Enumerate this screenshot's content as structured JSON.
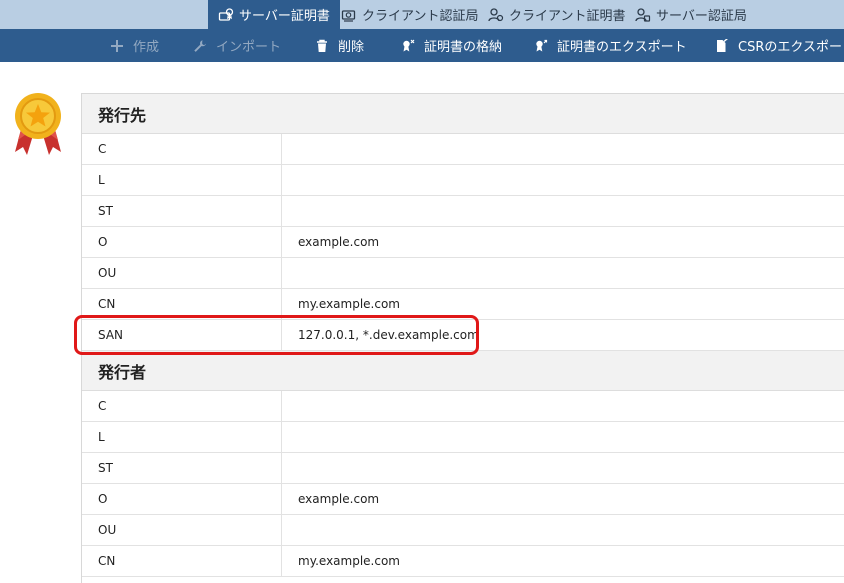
{
  "tabs": [
    {
      "label": "サーバー証明書",
      "icon": "server-cert-icon",
      "active": true
    },
    {
      "label": "クライアント認証局",
      "icon": "client-ca-icon",
      "active": false
    },
    {
      "label": "クライアント証明書",
      "icon": "client-cert-icon",
      "active": false
    },
    {
      "label": "サーバー認証局",
      "icon": "server-ca-icon",
      "active": false
    }
  ],
  "toolbar": [
    {
      "label": "作成",
      "icon": "plus-icon",
      "enabled": false
    },
    {
      "label": "インポート",
      "icon": "wrench-icon",
      "enabled": false
    },
    {
      "label": "削除",
      "icon": "trash-icon",
      "enabled": true
    },
    {
      "label": "証明書の格納",
      "icon": "cert-store-icon",
      "enabled": true
    },
    {
      "label": "証明書のエクスポート",
      "icon": "cert-export-icon",
      "enabled": true
    },
    {
      "label": "CSRのエクスポート",
      "icon": "file-export-icon",
      "enabled": true
    }
  ],
  "subject": {
    "title": "発行先",
    "rows": [
      {
        "key": "C",
        "value": ""
      },
      {
        "key": "L",
        "value": ""
      },
      {
        "key": "ST",
        "value": ""
      },
      {
        "key": "O",
        "value": "example.com"
      },
      {
        "key": "OU",
        "value": ""
      },
      {
        "key": "CN",
        "value": "my.example.com"
      },
      {
        "key": "SAN",
        "value": "127.0.0.1, *.dev.example.com"
      }
    ]
  },
  "issuer": {
    "title": "発行者",
    "rows": [
      {
        "key": "C",
        "value": ""
      },
      {
        "key": "L",
        "value": ""
      },
      {
        "key": "ST",
        "value": ""
      },
      {
        "key": "O",
        "value": "example.com"
      },
      {
        "key": "OU",
        "value": ""
      },
      {
        "key": "CN",
        "value": "my.example.com"
      }
    ]
  },
  "colors": {
    "tabbar": "#b9cee3",
    "toolbar": "#2e5c8e",
    "highlight": "#e01818",
    "badge_gold": "#f1b21c",
    "ribbon": "#c8312e"
  }
}
